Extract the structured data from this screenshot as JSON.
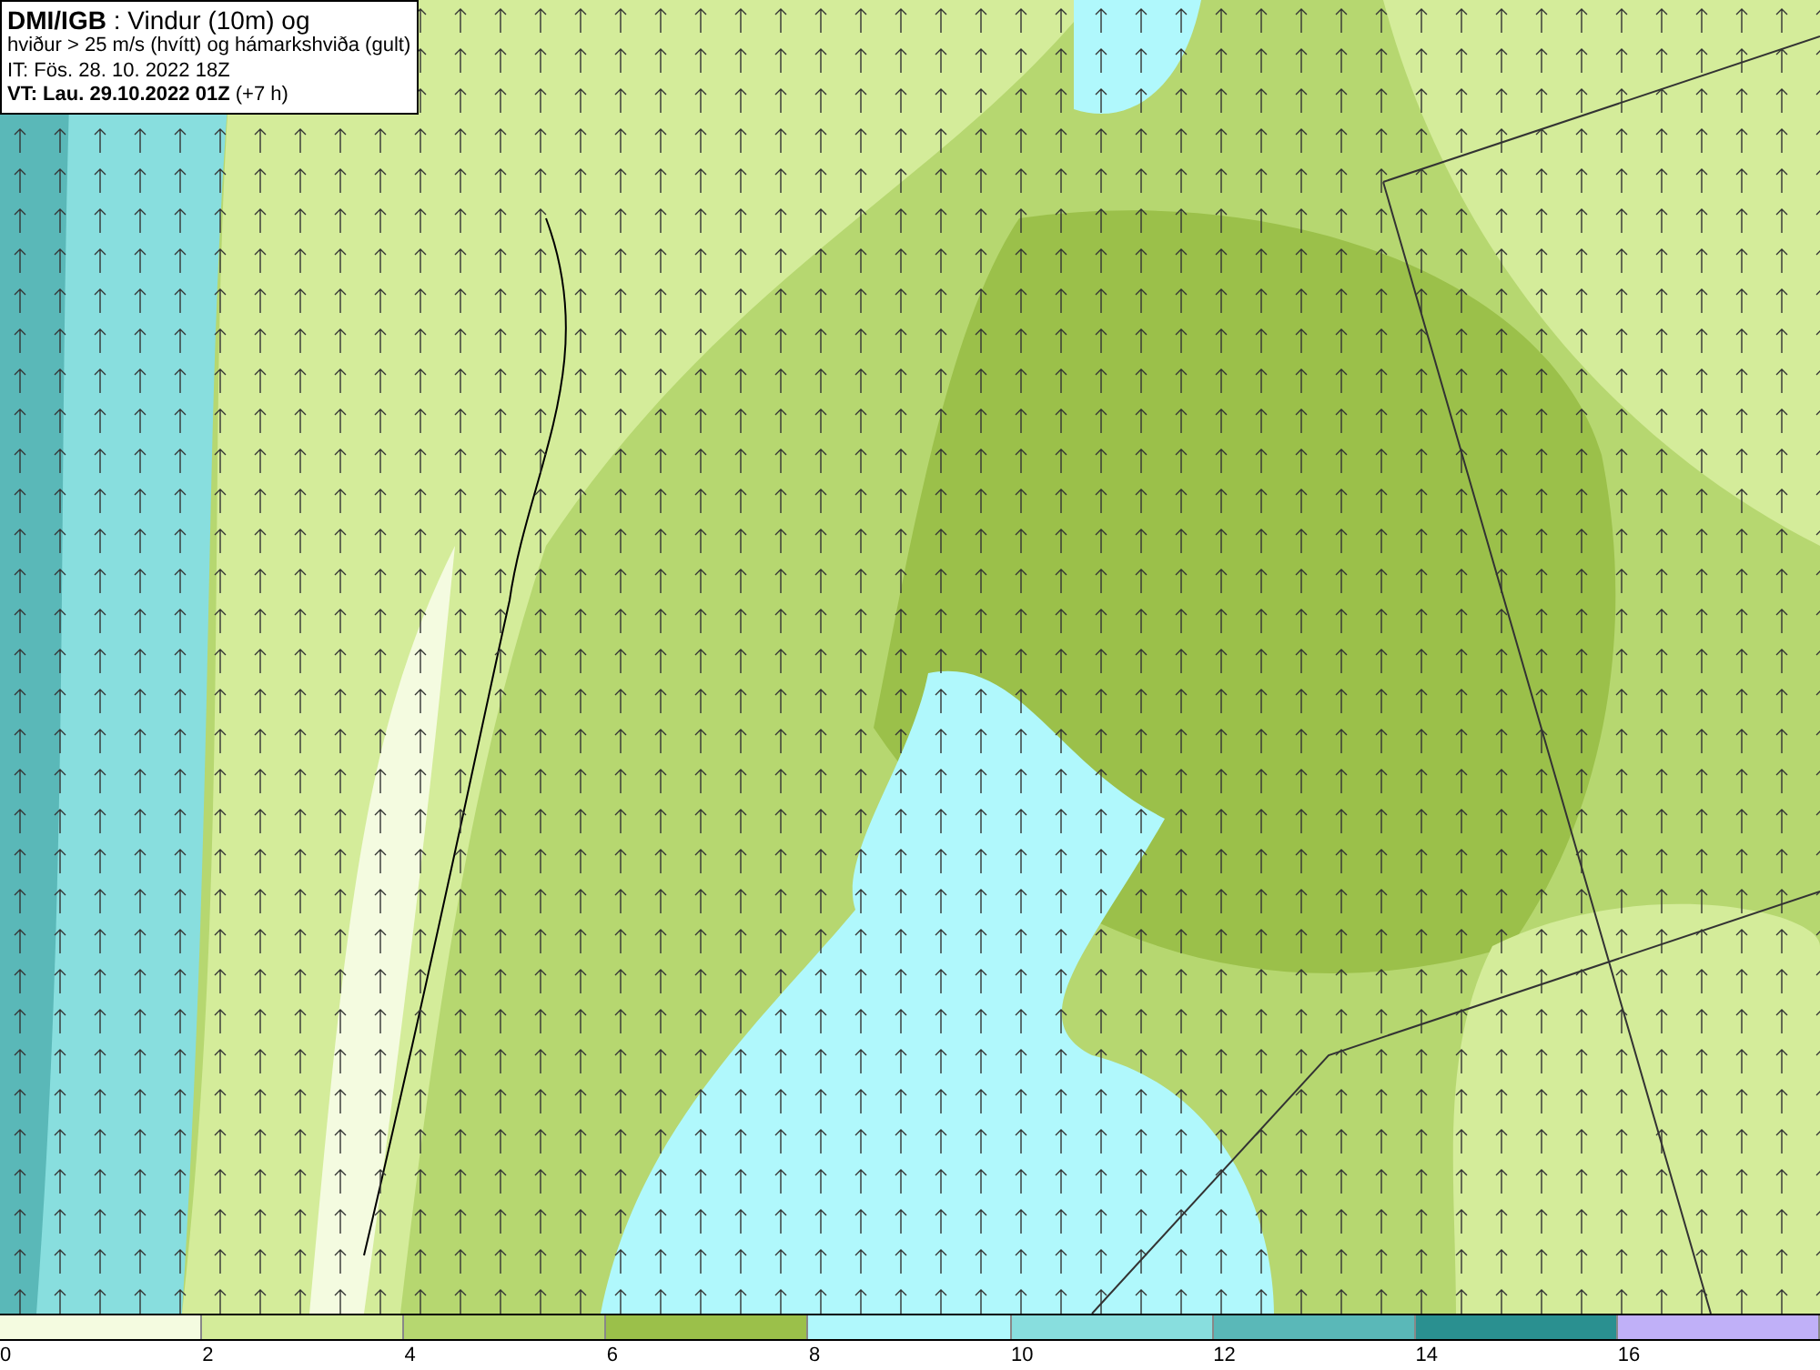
{
  "header": {
    "lines": [
      "**DMI/IGB** : Vindur (10m) og",
      "hviður > 25 m/s (hvítt) og hámarkshviða (gult)",
      "IT: Fös. 28. 10. 2022 18Z",
      "**VT: Lau. 29.10.2022 01Z** (+7 h)"
    ]
  },
  "legend": [
    {
      "label": "0",
      "color": "#f4fbe0"
    },
    {
      "label": "2",
      "color": "#d4ec9a"
    },
    {
      "label": "4",
      "color": "#b6d770"
    },
    {
      "label": "6",
      "color": "#9bc04a"
    },
    {
      "label": "8",
      "color": "#b0f8fc"
    },
    {
      "label": "10",
      "color": "#88dede"
    },
    {
      "label": "12",
      "color": "#5ab8b8"
    },
    {
      "label": "14",
      "color": "#2a9090"
    },
    {
      "label": "16",
      "color": "#c0b0f8"
    }
  ]
}
